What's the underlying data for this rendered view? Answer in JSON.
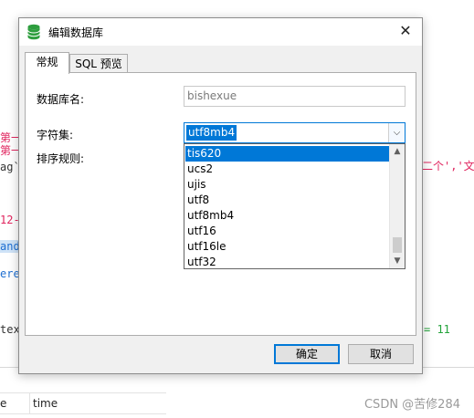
{
  "background": {
    "left_fragments": [
      "第一",
      "第一",
      "ag`",
      "12-",
      "and",
      "ere",
      "tex"
    ],
    "right_fragments": [
      "二个','文",
      "= 11"
    ],
    "bottom_table": {
      "col1": "e",
      "col2": "time"
    },
    "watermark": "CSDN @苦修284"
  },
  "dialog": {
    "title": "编辑数据库",
    "close_symbol": "✕",
    "tabs": [
      {
        "label": "常规",
        "active": true
      },
      {
        "label": "SQL 预览",
        "active": false
      }
    ],
    "fields": {
      "db_name_label": "数据库名:",
      "db_name_value": "bishexue",
      "charset_label": "字符集:",
      "charset_value": "utf8mb4",
      "collation_label": "排序规则:"
    },
    "charset_options": [
      "tis620",
      "ucs2",
      "ujis",
      "utf8",
      "utf8mb4",
      "utf16",
      "utf16le",
      "utf32"
    ],
    "highlighted_option": "tis620",
    "buttons": {
      "ok": "确定",
      "cancel": "取消"
    }
  },
  "colors": {
    "accent": "#0078d7",
    "db_icon": "#2e9e3e"
  },
  "icons": [
    "database-icon",
    "close-icon",
    "chevron-down-icon",
    "scroll-up-icon",
    "scroll-down-icon"
  ]
}
